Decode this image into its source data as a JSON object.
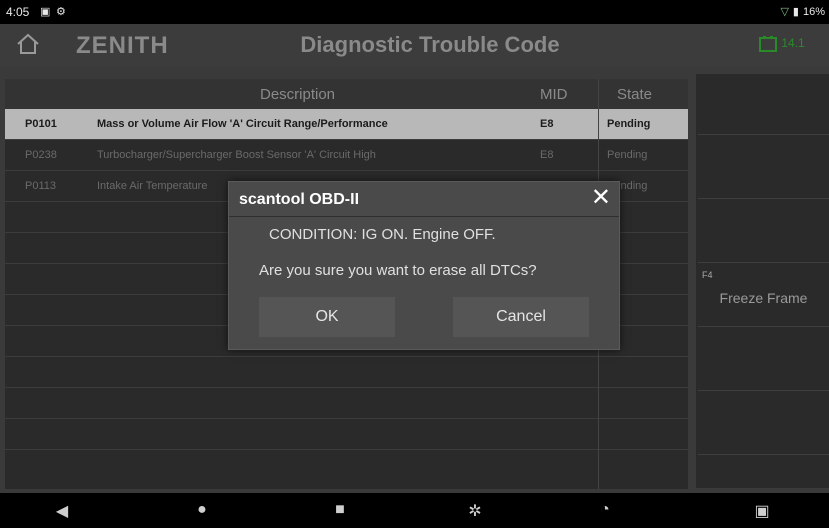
{
  "status_bar": {
    "time": "4:05",
    "battery": "16%",
    "icons": [
      "screen-icon",
      "settings-icon",
      "wifi-icon",
      "battery-icon"
    ]
  },
  "header": {
    "logo": "ZENITH",
    "title": "Diagnostic Trouble Code",
    "vehicle_battery": "14.1"
  },
  "table": {
    "columns": {
      "description": "Description",
      "mid": "MID",
      "state": "State"
    },
    "rows": [
      {
        "code": "P0101",
        "description": "Mass or Volume Air Flow 'A' Circuit Range/Performance",
        "mid": "E8",
        "state": "Pending",
        "selected": true
      },
      {
        "code": "P0238",
        "description": "Turbocharger/Supercharger Boost Sensor 'A' Circuit High",
        "mid": "E8",
        "state": "Pending",
        "selected": false
      },
      {
        "code": "P0113",
        "description": "Intake Air Temperature",
        "mid": "",
        "state": "Pending",
        "selected": false
      }
    ]
  },
  "sidebar": {
    "freeze_frame": {
      "fkey": "F4",
      "label": "Freeze Frame"
    }
  },
  "dialog": {
    "title": "scantool OBD-II",
    "message_1": "CONDITION: IG ON. Engine OFF.",
    "message_2": "Are you sure you want to erase all DTCs?",
    "ok_label": "OK",
    "cancel_label": "Cancel"
  },
  "colors": {
    "selected_row": "#b8b8b8",
    "dialog_bg": "#4a4a4a",
    "battery_indicator": "#2a8a2a"
  }
}
